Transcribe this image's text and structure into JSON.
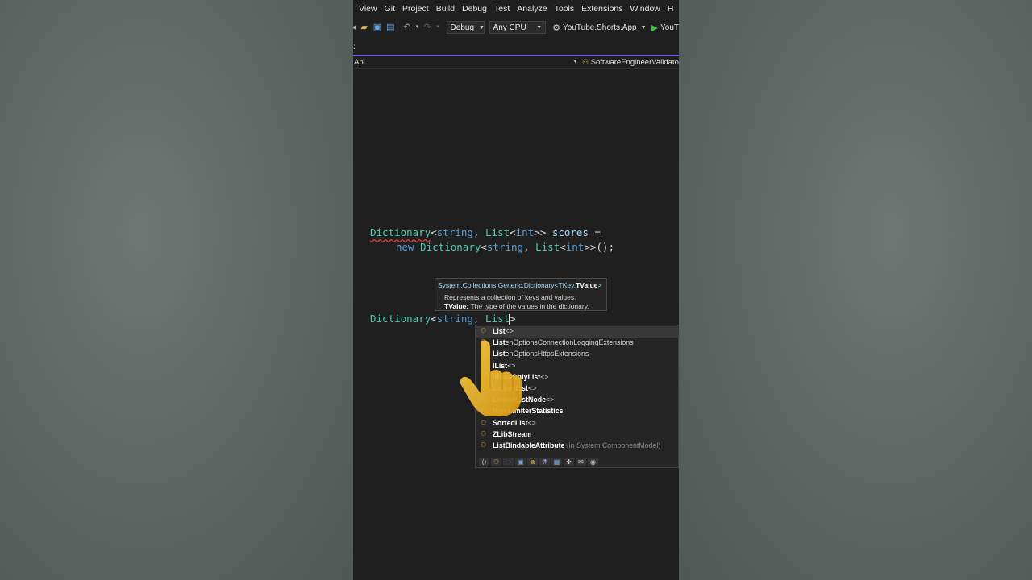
{
  "menu": [
    "View",
    "Git",
    "Project",
    "Build",
    "Debug",
    "Test",
    "Analyze",
    "Tools",
    "Extensions",
    "Window",
    "H"
  ],
  "toolbar": {
    "config": "Debug",
    "platform": "Any CPU",
    "startup_project": "YouTube.Shorts.App",
    "run_label": "YouT"
  },
  "tab_indicator": ":",
  "nav": {
    "left": "Api",
    "right": "SoftwareEngineerValidator"
  },
  "code": {
    "line1": {
      "t1": "Dictionary",
      "p1": "<",
      "k1": "string",
      "p2": ", ",
      "t2": "List",
      "p3": "<",
      "k2": "int",
      "p4": ">> ",
      "v1": "scores",
      "p5": " ="
    },
    "line2": {
      "k1": "new",
      "sp": " ",
      "t1": "Dictionary",
      "p1": "<",
      "k2": "string",
      "p2": ", ",
      "t2": "List",
      "p3": "<",
      "k3": "int",
      "p4": ">>();"
    },
    "line3": {
      "t1": "Dictionary",
      "p1": "<",
      "k1": "string",
      "p2": ", ",
      "t2": "List",
      "p3": ">"
    }
  },
  "tooltip": {
    "title_prefix": "System.Collections.Generic.Dictionary<TKey,",
    "title_bold": "TValue",
    "title_suffix": ">",
    "description": "Represents a collection of keys and values.",
    "param_name": "TValue:",
    "param_desc": " The type of the values in the dictionary."
  },
  "completion": {
    "items": [
      {
        "match": "List",
        "rest": "<>",
        "icon": "class",
        "selected": true
      },
      {
        "match": "List",
        "rest": "enOptionsConnectionLoggingExtensions",
        "icon": "class"
      },
      {
        "match": "List",
        "rest": "enOptionsHttpsExtensions",
        "icon": "class"
      },
      {
        "match": "IList",
        "rest": "<>",
        "icon": "interface"
      },
      {
        "match": "IReadOnlyList",
        "rest": "<>",
        "icon": "interface"
      },
      {
        "match": "LinkedList",
        "rest": "<>",
        "icon": "class"
      },
      {
        "match": "LinkedListNode",
        "rest": "<>",
        "icon": "class"
      },
      {
        "match": "RateLimiterStatistics",
        "rest": "",
        "icon": "class"
      },
      {
        "match": "SortedList",
        "rest": "<>",
        "icon": "class"
      },
      {
        "match": "ZLibStream",
        "rest": "",
        "icon": "class"
      },
      {
        "match": "ListBindableAttribute",
        "rest": "",
        "suffix": " (in System.ComponentModel)",
        "icon": "class"
      }
    ]
  }
}
